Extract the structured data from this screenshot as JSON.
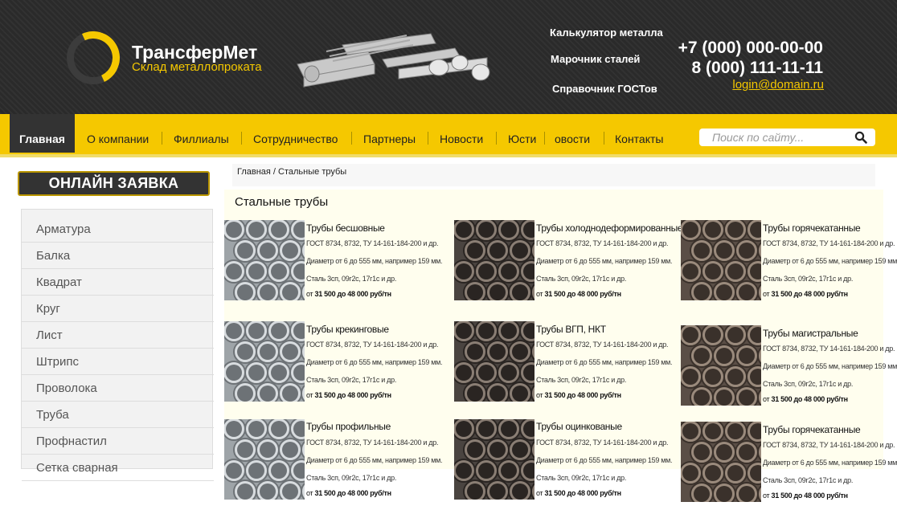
{
  "header": {
    "logo_title": "ТрансферМет",
    "logo_subtitle": "Склад металлопроката",
    "links": [
      "Калькулятор металла",
      "Марочник сталей",
      "Справочник ГОСТов"
    ],
    "phones": [
      "+7 (000) 000-00-00",
      "8 (000) 111-11-11"
    ],
    "email": "login@domain.ru"
  },
  "nav": {
    "items": [
      "Главная",
      "О компании",
      "Филлиалы",
      "Сотрудничество",
      "Партнеры",
      "Новости",
      "Юсти",
      "овости",
      "Контакты"
    ],
    "active": "Главная"
  },
  "search": {
    "placeholder": "Поиск по сайту..."
  },
  "sidebar": {
    "order_button": "ОНЛАЙН ЗАЯВКА",
    "items": [
      "Арматура",
      "Балка",
      "Квадрат",
      "Круг",
      "Лист",
      "Штрипс",
      "Проволока",
      "Труба",
      "Профнастил",
      "Сетка сварная"
    ]
  },
  "breadcrumb": "Главная / Стальные трубы",
  "page_title": "Стальные трубы",
  "products": [
    {
      "title": "Трубы бесшовные",
      "gost": "ГОСТ 8734, 8732, ТУ 14-161-184-200 и др.",
      "diameter": "Диаметр от 6 до 555 мм, например 159 мм.",
      "steel": "Сталь 3сп, 09г2с, 17г1с и др.",
      "price_prefix": "от",
      "price": "31 500 до 48 000 руб/тн",
      "image": "silver-pipes"
    },
    {
      "title": "Трубы холоднодеформированные",
      "gost": "ГОСТ 8734, 8732, ТУ 14-161-184-200 и др.",
      "diameter": "Диаметр от 6 до 555 мм, например 159 мм.",
      "steel": "Сталь 3сп, 09г2с, 17г1с и др.",
      "price_prefix": "от",
      "price": "31 500 до 48 000 руб/тн",
      "image": "dark-pipes"
    },
    {
      "title": "Трубы горячекатанные",
      "gost": "ГОСТ 8734, 8732, ТУ 14-161-184-200 и др.",
      "diameter": "Диаметр от 6 до 555 мм, например 159 мм.",
      "steel": "Сталь 3сп, 09г2с, 17г1с и др.",
      "price_prefix": "от",
      "price": "31 500 до 48 000 руб/тн",
      "image": "rust-pipes"
    },
    {
      "title": "Трубы крекинговые",
      "gost": "ГОСТ 8734, 8732, ТУ 14-161-184-200 и др.",
      "diameter": "Диаметр от 6 до 555 мм, например 159 мм.",
      "steel": "Сталь 3сп, 09г2с, 17г1с и др.",
      "price_prefix": "от",
      "price": "31 500 до 48 000 руб/тн",
      "image": "silver-pipes"
    },
    {
      "title": "Трубы ВГП, НКТ",
      "gost": "ГОСТ 8734, 8732, ТУ 14-161-184-200 и др.",
      "diameter": "Диаметр от 6 до 555 мм, например 159 мм.",
      "steel": "Сталь 3сп, 09г2с, 17г1с и др.",
      "price_prefix": "от",
      "price": "31 500 до 48 000 руб/тн",
      "image": "dark-pipes"
    },
    {
      "title": "Трубы магистральные",
      "gost": "ГОСТ 8734, 8732, ТУ 14-161-184-200 и др.",
      "diameter": "Диаметр от 6 до 555 мм, например 159 мм.",
      "steel": "Сталь 3сп, 09г2с, 17г1с и др.",
      "price_prefix": "от",
      "price": "31 500 до 48 000 руб/тн",
      "image": "rust-pipes"
    },
    {
      "title": "Трубы профильные",
      "gost": "ГОСТ 8734, 8732, ТУ 14-161-184-200 и др.",
      "diameter": "Диаметр от 6 до 555 мм, например 159 мм.",
      "steel": "Сталь 3сп, 09г2с, 17г1с и др.",
      "price_prefix": "от",
      "price": "31 500 до 48 000 руб/тн",
      "image": "silver-pipes"
    },
    {
      "title": "Трубы оцинкованые",
      "gost": "ГОСТ 8734, 8732, ТУ 14-161-184-200 и др.",
      "diameter": "Диаметр от 6 до 555 мм, например 159 мм.",
      "steel": "Сталь 3сп, 09г2с, 17г1с и др.",
      "price_prefix": "от",
      "price": "31 500 до 48 000 руб/тн",
      "image": "dark-pipes"
    },
    {
      "title": "Трубы горячекатанные",
      "gost": "ГОСТ 8734, 8732, ТУ 14-161-184-200 и др.",
      "diameter": "Диаметр от 6 до 555 мм, например 159 мм.",
      "steel": "Сталь 3сп, 09г2с, 17г1с и др.",
      "price_prefix": "от",
      "price": "31 500 до 48 000 руб/тн",
      "image": "rust-pipes"
    }
  ],
  "colors": {
    "accent": "#f5c800",
    "header_bg": "#2a2a2a",
    "nav_active_bg": "#333333"
  }
}
